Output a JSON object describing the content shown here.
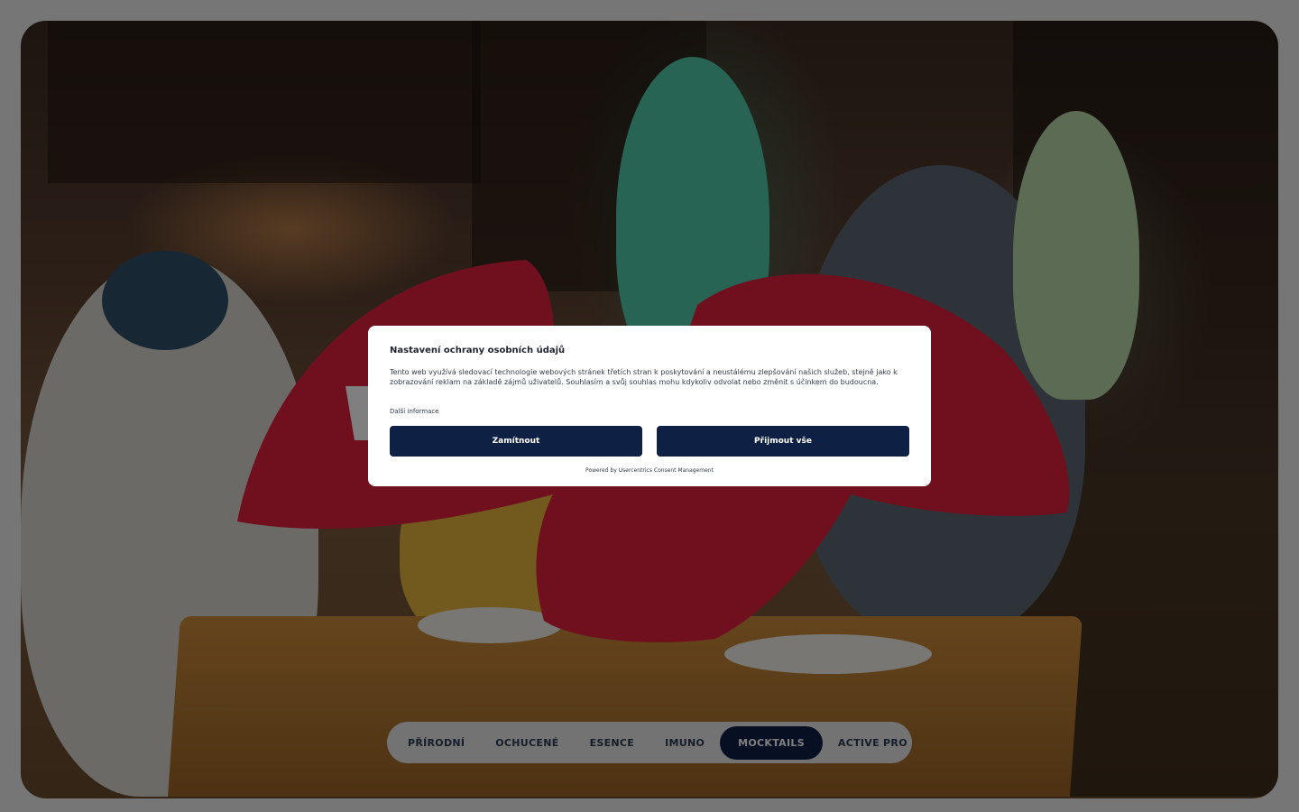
{
  "categories": {
    "tabs": [
      {
        "label": "PŘÍRODNÍ"
      },
      {
        "label": "OCHUCENÉ"
      },
      {
        "label": "ESENCE"
      },
      {
        "label": "IMUNO"
      },
      {
        "label": "MOCKTAILS"
      },
      {
        "label": "ACTIVE PRO"
      }
    ],
    "active": "MOCKTAILS"
  },
  "consent": {
    "title": "Nastavení ochrany osobních údajů",
    "text": "Tento web využívá sledovací technologie webových stránek třetích stran k poskytování a neustálému zlepšování našich služeb, stejně jako k zobrazování reklam na základě zájmů uživatelů. Souhlasím a svůj souhlas mohu kdykoliv odvolat nebo změnit s účinkem do budoucna.",
    "more_info": "Další informace",
    "deny_label": "Zamítnout",
    "accept_label": "Přijmout vše",
    "powered_by": "Powered by Usercentrics Consent Management"
  },
  "colors": {
    "brand_navy": "#0f2045",
    "wings_red": "#e0213f",
    "overlay": "rgba(0,0,0,0.5)"
  }
}
